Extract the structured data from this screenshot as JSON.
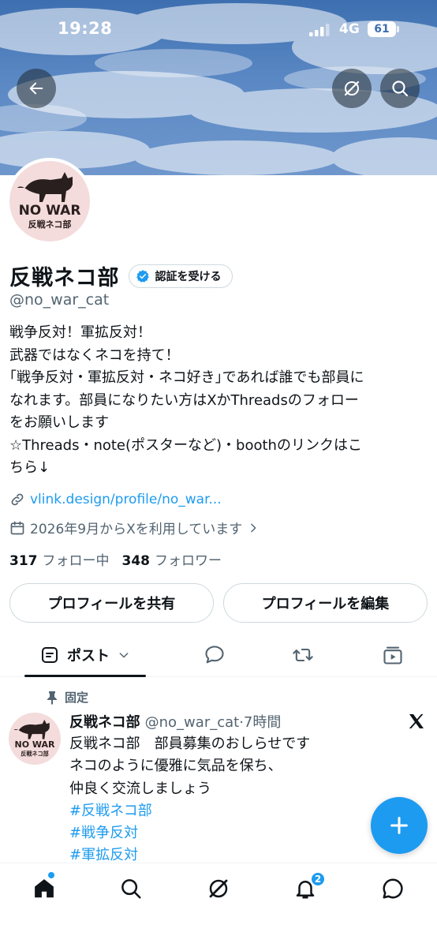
{
  "status_bar": {
    "time": "19:28",
    "network": "4G",
    "battery": "61"
  },
  "profile": {
    "display_name": "反戦ネコ部",
    "verify_label": "認証を受ける",
    "handle": "@no_war_cat",
    "bio_lines": [
      "戦争反対！軍拡反対！",
      "武器ではなくネコを持て！",
      "｢戦争反対・軍拡反対・ネコ好き｣であれば誰でも部員に",
      "なれます。部員になりたい方はXかThreadsのフォロー",
      "をお願いします",
      "☆Threads・note(ポスターなど)・boothのリンクはこ",
      "ちら↓"
    ],
    "link": "vlink.design/profile/no_war...",
    "joined": "2026年9月からXを利用しています",
    "following_count": "317",
    "following_label": "フォロー中",
    "followers_count": "348",
    "followers_label": "フォロワー",
    "avatar_text_top": "NO WAR",
    "avatar_text_bottom": "反戦ネコ部"
  },
  "actions": {
    "share_label": "プロフィールを共有",
    "edit_label": "プロフィールを編集"
  },
  "tabs": {
    "posts_label": "ポスト"
  },
  "post": {
    "pinned_label": "固定",
    "name": "反戦ネコ部",
    "handle_time": "@no_war_cat·7時間",
    "lines": [
      "反戦ネコ部　部員募集のおしらせです",
      "ネコのように優雅に気品を保ち、",
      "仲良く交流しましょう"
    ],
    "hashtags": [
      "#反戦ネコ部",
      "#戦争反対",
      "#軍拡反対"
    ]
  },
  "nav": {
    "notification_count": "2"
  },
  "icons": {
    "back": "back-arrow-icon",
    "grok": "grok-icon",
    "search": "search-icon",
    "verified": "verified-check-icon",
    "link": "link-icon",
    "calendar": "calendar-icon",
    "chevron": "chevron-right-icon",
    "pin": "pin-icon",
    "x": "x-logo-icon",
    "compose": "plus-icon"
  },
  "colors": {
    "accent": "#1d9bf0",
    "text": "#0f1419",
    "secondary": "#536471",
    "avatar_bg": "#f4dcdc"
  }
}
